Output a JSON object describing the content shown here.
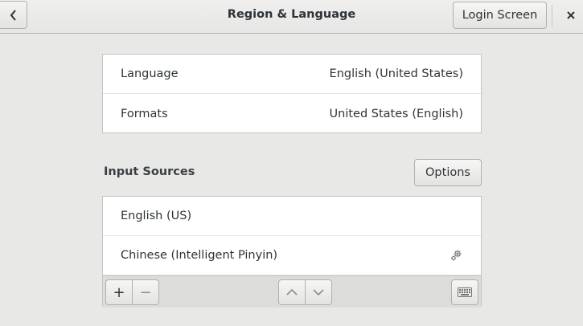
{
  "window": {
    "title": "Region & Language",
    "login_screen_label": "Login Screen"
  },
  "language_section": {
    "rows": [
      {
        "label": "Language",
        "value": "English (United States)"
      },
      {
        "label": "Formats",
        "value": "United States (English)"
      }
    ]
  },
  "input_sources": {
    "title": "Input Sources",
    "options_label": "Options",
    "items": [
      {
        "label": "English (US)"
      },
      {
        "label": "Chinese (Intelligent Pinyin)",
        "icon": "gear-icon"
      }
    ],
    "toolbar": {
      "add_label": "+",
      "remove_label": "−"
    }
  }
}
